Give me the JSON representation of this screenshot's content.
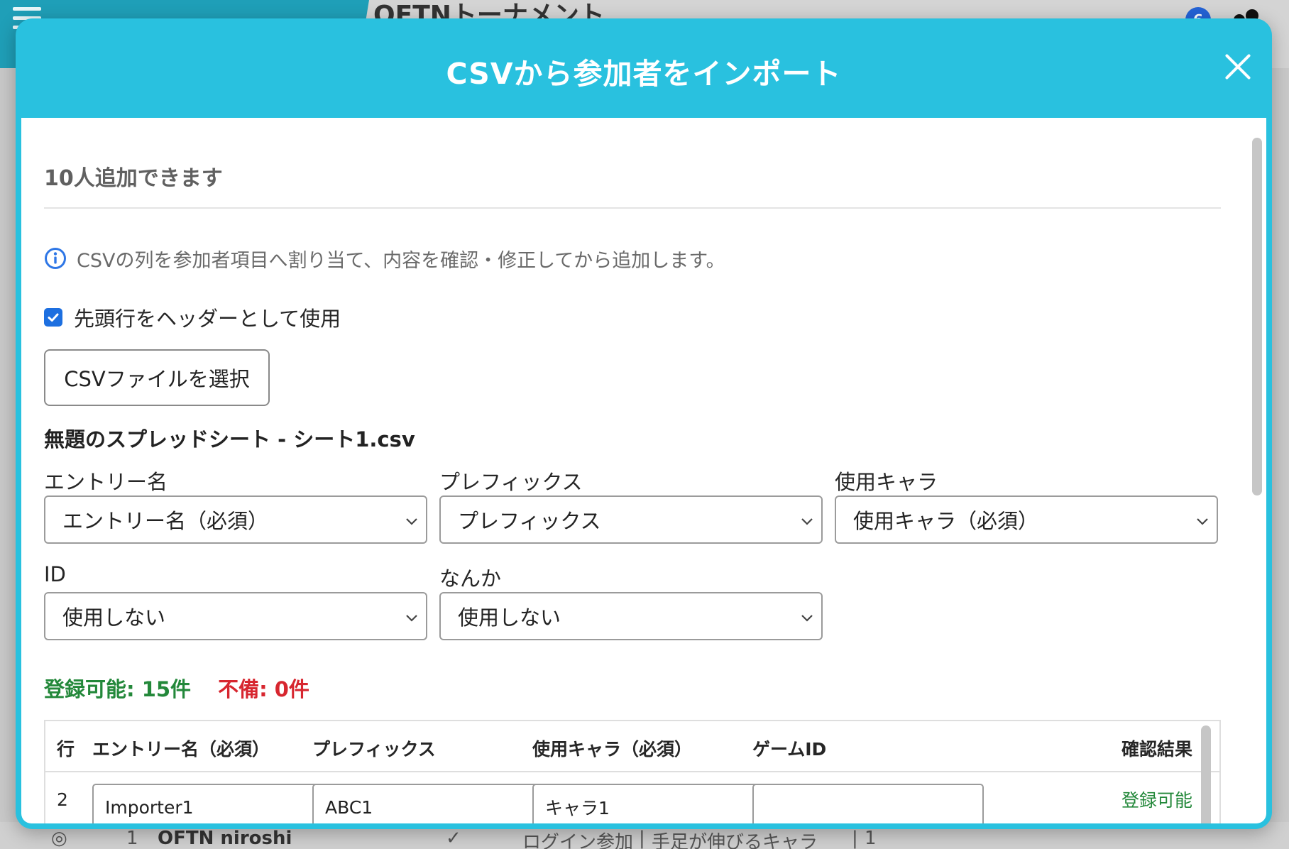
{
  "background": {
    "app_title": "OFTNトーナメント",
    "badge_count": "6",
    "row": {
      "rank": "1",
      "entry": "OFTN niroshi",
      "mode": "ログイン参加",
      "character": "手足が伸びるキャラ",
      "count": "1"
    }
  },
  "modal": {
    "title": "CSVから参加者をインポート",
    "count_text": "10人追加できます",
    "info_text": "CSVの列を参加者項目へ割り当て、内容を確認・修正してから追加します。",
    "header_checkbox_label": "先頭行をヘッダーとして使用",
    "header_checkbox_checked": true,
    "file_button_label": "CSVファイルを選択",
    "file_name": "無題のスプレッドシート - シート1.csv",
    "mappings": [
      {
        "label": "エントリー名",
        "value": "エントリー名（必須）"
      },
      {
        "label": "プレフィックス",
        "value": "プレフィックス"
      },
      {
        "label": "使用キャラ",
        "value": "使用キャラ（必須）"
      },
      {
        "label": "ID",
        "value": "使用しない"
      },
      {
        "label": "なんか",
        "value": "使用しない"
      }
    ],
    "status_ok": "登録可能: 15件",
    "status_ng": "不備: 0件",
    "colors": {
      "header": "#29c1df",
      "ok": "#23883a",
      "ng": "#d7262f",
      "checkbox": "#1d6fe0"
    },
    "table": {
      "headers": [
        "行",
        "エントリー名（必須）",
        "プレフィックス",
        "使用キャラ（必須）",
        "ゲームID",
        "確認結果"
      ],
      "rows": [
        {
          "row": "2",
          "entry": "Importer1",
          "prefix": "ABC1",
          "character": "キャラ1",
          "game_id": "",
          "result": "登録可能"
        }
      ]
    }
  }
}
